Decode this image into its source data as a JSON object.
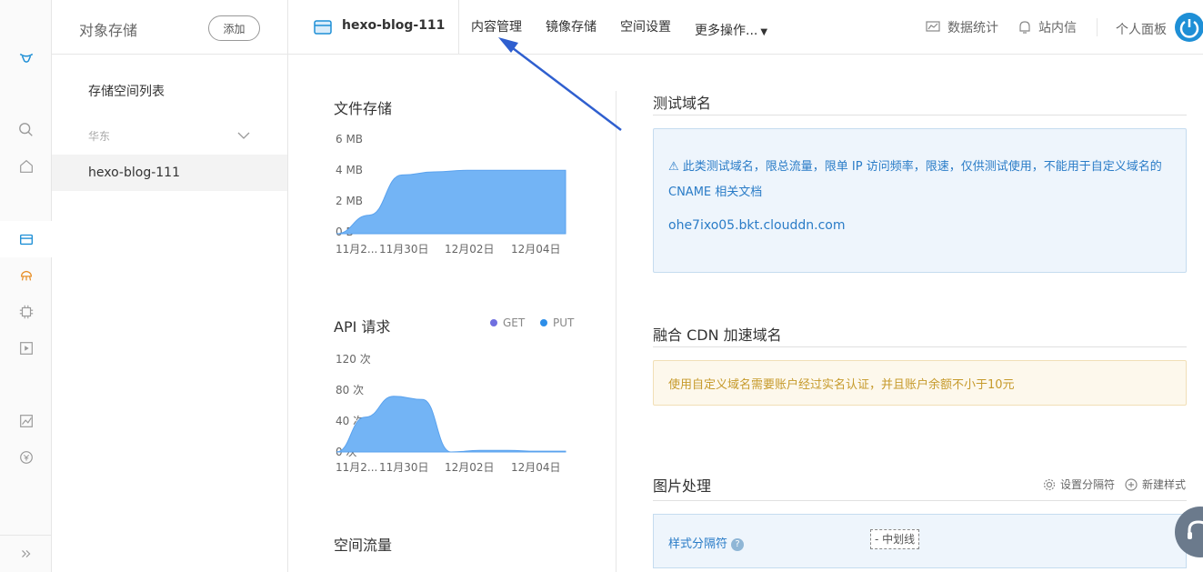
{
  "sidebar": {
    "title": "对象存储",
    "add_label": "添加",
    "list_title": "存储空间列表",
    "region": "华东",
    "bucket": "hexo-blog-111"
  },
  "topbar": {
    "bucket_name": "hexo-blog-111",
    "nav": [
      "内容管理",
      "镜像存储",
      "空间设置",
      "更多操作..."
    ],
    "stats": "数据统计",
    "messages": "站内信",
    "profile": "个人面板"
  },
  "storage": {
    "title": "文件存储"
  },
  "api": {
    "title": "API 请求",
    "legend_get": "GET",
    "legend_put": "PUT"
  },
  "traffic": {
    "title": "空间流量"
  },
  "test_domain": {
    "title": "测试域名",
    "notice": "此类测试域名，限总流量，限单 IP 访问频率，限速，仅供测试使用，不能用于自定义域名的 CNAME",
    "doc_link": "相关文档",
    "domain": "ohe7ixo05.bkt.clouddn.com"
  },
  "cdn": {
    "title": "融合 CDN 加速域名",
    "warning": "使用自定义域名需要账户经过实名认证，并且账户余额不小于10元"
  },
  "image": {
    "title": "图片处理",
    "set_separator": "设置分隔符",
    "new_style": "新建样式",
    "separator_label": "样式分隔符",
    "separator_value": "- 中划线"
  },
  "colors": {
    "accent": "#2a7cc7",
    "chart_fill": "#73b4f5",
    "get": "#6f6fe0",
    "put": "#2d8ee8"
  },
  "chart_data": [
    {
      "type": "area",
      "title": "文件存储",
      "xlabel": "",
      "ylabel": "",
      "x_ticks": [
        "11月2...",
        "11月30日",
        "12月02日",
        "12月04日"
      ],
      "y_ticks": [
        "0 B",
        "2 MB",
        "4 MB",
        "6 MB"
      ],
      "ylim": [
        0,
        6
      ],
      "series": [
        {
          "values": [
            0,
            1.2,
            3.8,
            4.0,
            4.1,
            4.1,
            4.1,
            4.1
          ]
        }
      ]
    },
    {
      "type": "area",
      "title": "API 请求",
      "xlabel": "",
      "ylabel": "",
      "x_ticks": [
        "11月2...",
        "11月30日",
        "12月02日",
        "12月04日"
      ],
      "y_ticks": [
        "0 次",
        "40 次",
        "80 次",
        "120 次"
      ],
      "ylim": [
        0,
        120
      ],
      "series": [
        {
          "name": "GET",
          "values": [
            0,
            45,
            72,
            68,
            0,
            2,
            2,
            1,
            1
          ]
        },
        {
          "name": "PUT",
          "values": [
            0,
            0,
            0,
            0,
            0,
            0,
            0,
            0,
            0
          ]
        }
      ]
    }
  ]
}
